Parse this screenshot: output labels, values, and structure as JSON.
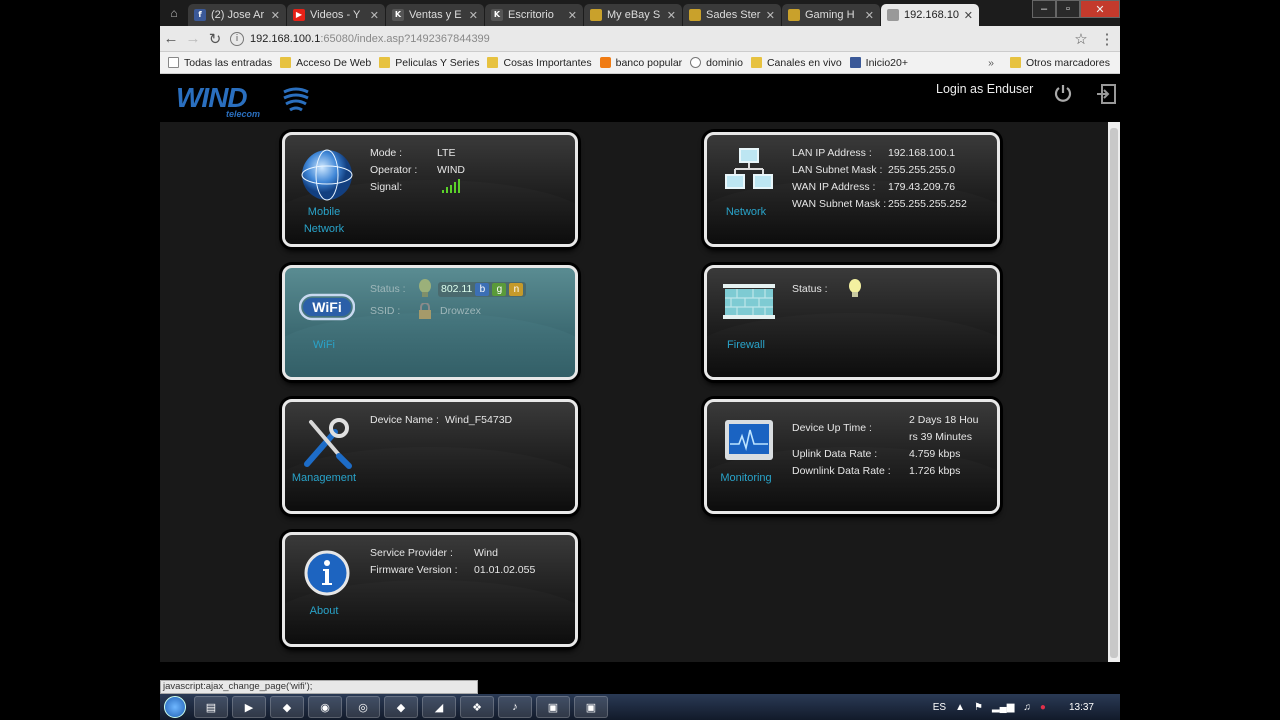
{
  "browser": {
    "tabs": [
      {
        "title": "(2) Jose Ar",
        "icon": "facebook-icon",
        "color": "#3b5998",
        "glyph": "f"
      },
      {
        "title": "Videos - Y",
        "icon": "youtube-icon",
        "color": "#e62117",
        "glyph": "▶"
      },
      {
        "title": "Ventas y E",
        "icon": "k-icon",
        "color": "#555555",
        "glyph": "K"
      },
      {
        "title": "Escritorio",
        "icon": "k-icon",
        "color": "#555555",
        "glyph": "K"
      },
      {
        "title": "My eBay S",
        "icon": "flag-icon",
        "color": "#c9a12b",
        "glyph": ""
      },
      {
        "title": "Sades Ster",
        "icon": "flag-icon",
        "color": "#c9a12b",
        "glyph": ""
      },
      {
        "title": "Gaming H",
        "icon": "flag-icon",
        "color": "#c9a12b",
        "glyph": ""
      },
      {
        "title": "192.168.10",
        "icon": "page-icon",
        "color": "#999999",
        "glyph": ""
      }
    ],
    "url_host": "192.168.100.1",
    "url_rest": ":65080/index.asp?1492367844399",
    "bookmarks": [
      {
        "label": "Todas las entradas",
        "type": "p"
      },
      {
        "label": "Acceso De Web",
        "type": "f"
      },
      {
        "label": "Peliculas Y Series",
        "type": "f"
      },
      {
        "label": "Cosas Importantes",
        "type": "f"
      },
      {
        "label": "banco popular",
        "type": "b"
      },
      {
        "label": "dominio",
        "type": "g"
      },
      {
        "label": "Canales en vivo",
        "type": "f"
      },
      {
        "label": "Inicio20+",
        "type": "fb"
      }
    ],
    "bookmarks_more": "»",
    "other_bookmarks": "Otros marcadores",
    "status_text": "javascript:ajax_change_page('wifi');"
  },
  "header": {
    "brand": "WIND",
    "brand_sub": "telecom",
    "login_text": "Login as Enduser"
  },
  "cards": {
    "mobile": {
      "label1": "Mobile",
      "label2": "Network",
      "mode_k": "Mode :",
      "mode_v": "LTE",
      "operator_k": "Operator :",
      "operator_v": "WIND",
      "signal_k": "Signal:",
      "signal_bars": 5
    },
    "network": {
      "label": "Network",
      "lan_ip_k": "LAN IP Address :",
      "lan_ip_v": "192.168.100.1",
      "lan_mask_k": "LAN Subnet Mask :",
      "lan_mask_v": "255.255.255.0",
      "wan_ip_k": "WAN IP Address :",
      "wan_ip_v": "179.43.209.76",
      "wan_mask_k": "WAN Subnet Mask :",
      "wan_mask_v": "255.255.255.252"
    },
    "wifi": {
      "label": "WiFi",
      "status_k": "Status :",
      "standard": "802.11",
      "modes": [
        "b",
        "g",
        "n"
      ],
      "ssid_k": "SSID :",
      "ssid_v": "Drowzex"
    },
    "firewall": {
      "label": "Firewall",
      "status_k": "Status :"
    },
    "management": {
      "label": "Management",
      "device_k": "Device Name :",
      "device_v": "Wind_F5473D"
    },
    "monitoring": {
      "label": "Monitoring",
      "uptime_k": "Device Up Time :",
      "uptime_v1": "2 Days 18 Hou",
      "uptime_v2": "rs 39 Minutes",
      "uplink_k": "Uplink Data Rate :",
      "uplink_v": "4.759  kbps",
      "downlink_k": "Downlink Data Rate :",
      "downlink_v": "1.726  kbps"
    },
    "about": {
      "label": "About",
      "provider_k": "Service Provider :",
      "provider_v": "Wind",
      "firmware_k": "Firmware Version :",
      "firmware_v": "01.01.02.055"
    }
  },
  "taskbar": {
    "lang": "ES",
    "time": "13:37"
  }
}
